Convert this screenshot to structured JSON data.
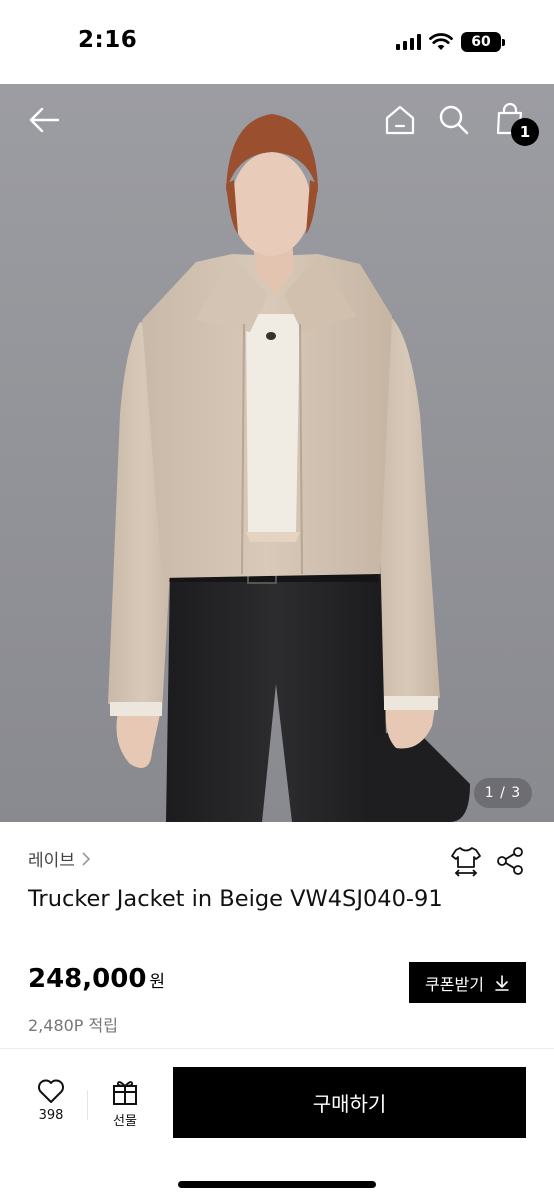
{
  "status_bar": {
    "time": "2:16",
    "battery_level": "60",
    "icons": [
      "cellular-signal-icon",
      "wifi-icon",
      "battery-icon"
    ]
  },
  "header": {
    "icons": [
      "back-arrow-icon",
      "home-icon",
      "search-icon",
      "shopping-bag-icon"
    ],
    "cart_count": "1"
  },
  "gallery": {
    "indicator": "1 / 3",
    "current": 1,
    "total": 3
  },
  "product": {
    "brand": "레이브",
    "title": "Trucker Jacket in Beige VW4SJ040-91",
    "price": "248,000",
    "price_unit": "원",
    "points": "2,480P 적립",
    "coupon_label": "쿠폰받기"
  },
  "bottom_bar": {
    "like_count": "398",
    "gift_label": "선물",
    "buy_label": "구매하기"
  },
  "colors": {
    "primary": "#000000",
    "background": "#ffffff",
    "muted_text": "#777777",
    "photo_background": "#8f9096"
  }
}
